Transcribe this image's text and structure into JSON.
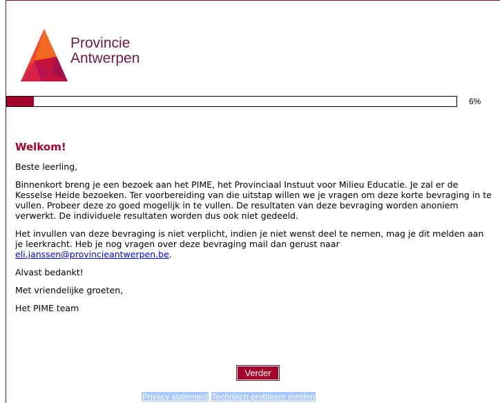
{
  "logo": {
    "line1": "Provincie",
    "line2": "Antwerpen"
  },
  "progress": {
    "percent": 6,
    "label": "6%"
  },
  "content": {
    "heading": "Welkom!",
    "greeting": "Beste leerling,",
    "paragraph1": "Binnenkort breng je een bezoek aan het PIME, het Provinciaal Instuut voor Milieu Educatie. Je zal er de Kesselse Heide bezoeken. Ter voorbereiding van die uitstap willen we je vragen om deze korte bevraging in te vullen. Probeer deze zo goed mogelijk in te vullen. De resultaten van deze bevraging worden anoniem verwerkt. De individuele resultaten worden dus ook niet gedeeld.",
    "paragraph2": "Het invullen van deze bevraging is niet verplicht, indien je niet wenst deel te nemen, mag je dit melden aan je leerkracht. Heb je nog vragen over deze bevraging mail dan gerust naar",
    "email": "eli.janssen@provincieantwerpen.be",
    "paragraph2_end": ".",
    "thanks": "Alvast bedankt!",
    "regards": "Met vriendelijke groeten,",
    "signature": "Het PIME team"
  },
  "buttons": {
    "next": "Verder"
  },
  "footer": {
    "privacy": "Privacy statement",
    "report": "Technisch probleem melden"
  },
  "colors": {
    "accent": "#a5042a",
    "brand_text": "#6b1a4a",
    "link_highlight": "#a8c8ff"
  }
}
